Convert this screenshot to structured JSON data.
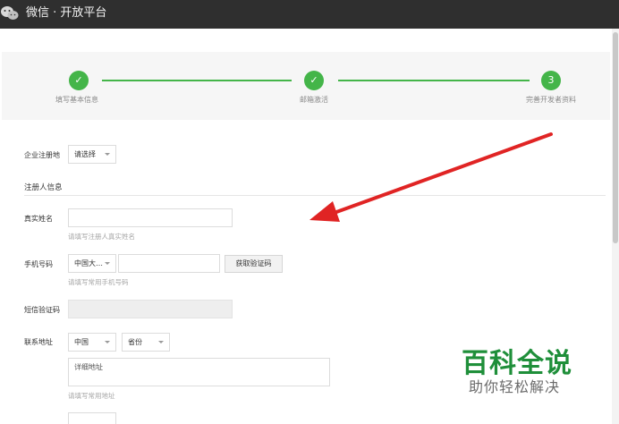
{
  "header": {
    "title": "微信 · 开放平台",
    "logo_icon": "wechat-icon",
    "bg_color": "#2f2f2f"
  },
  "steps": [
    {
      "label": "填写基本信息",
      "state": "done",
      "mark": "✓"
    },
    {
      "label": "邮箱激活",
      "state": "done",
      "mark": "✓"
    },
    {
      "label": "完善开发者资料",
      "state": "current",
      "mark": "3"
    }
  ],
  "accent_color": "#44b549",
  "form": {
    "region_label": "企业注册地",
    "region_value": "请选择",
    "registrant_section": "注册人信息",
    "name_label": "真实姓名",
    "name_value": "",
    "name_hint": "请填写注册人真实姓名",
    "phone_label": "手机号码",
    "phone_country": "中国大…",
    "phone_value": "",
    "get_code_button": "获取验证码",
    "phone_hint": "请填写常用手机号码",
    "sms_label": "短信验证码",
    "sms_value": "",
    "address_label": "联系地址",
    "address_country": "中国",
    "address_province": "省份",
    "address_detail_placeholder": "详细地址",
    "address_hint": "请填写常用地址"
  },
  "annotation": {
    "arrow_color": "#e02424"
  },
  "watermark": {
    "main": "百科全说",
    "sub": "助你轻松解决"
  }
}
